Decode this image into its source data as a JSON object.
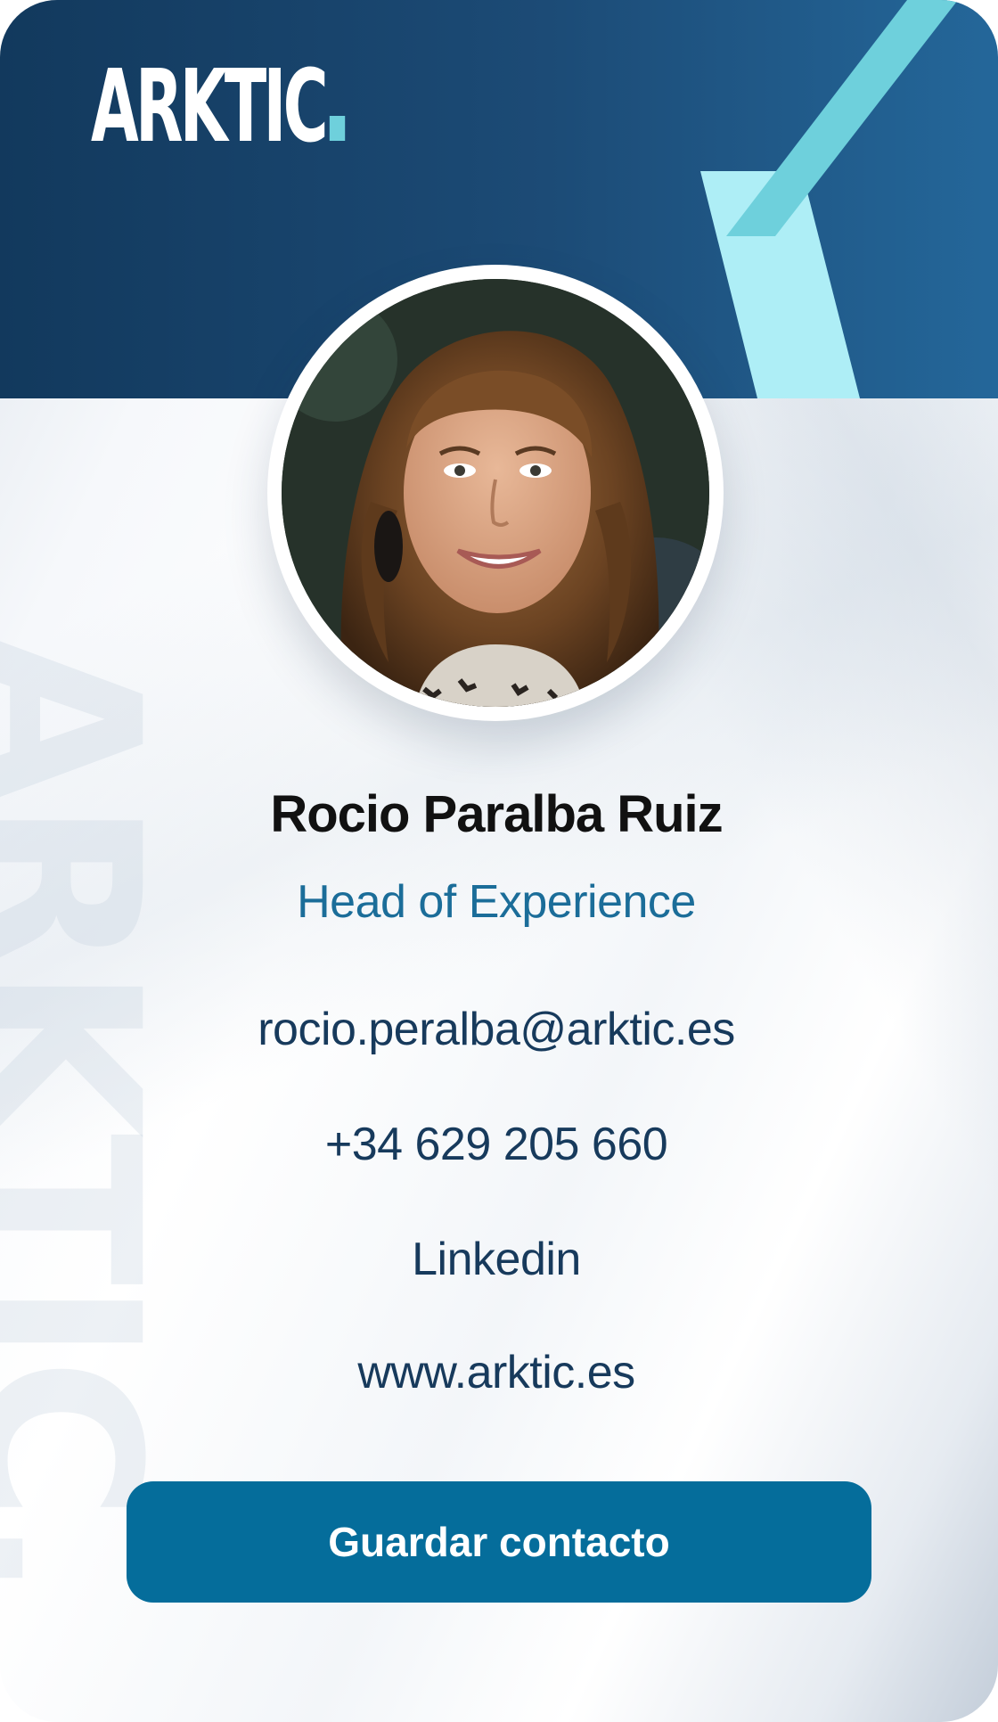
{
  "header": {
    "logo_text": "ARKTIC",
    "logo_dot_color": "#6ed0dc",
    "background_color": "#1c4b76"
  },
  "watermark": {
    "text": "ARKTIC."
  },
  "profile": {
    "name": "Rocio Paralba Ruiz",
    "role": "Head of Experience",
    "avatar_icon": "profile-photo"
  },
  "contacts": {
    "email": "rocio.peralba@arktic.es",
    "phone": "+34 629 205 660",
    "linkedin": "Linkedin",
    "website": "www.arktic.es"
  },
  "actions": {
    "save_label": "Guardar contacto",
    "save_color": "#056d9b"
  }
}
